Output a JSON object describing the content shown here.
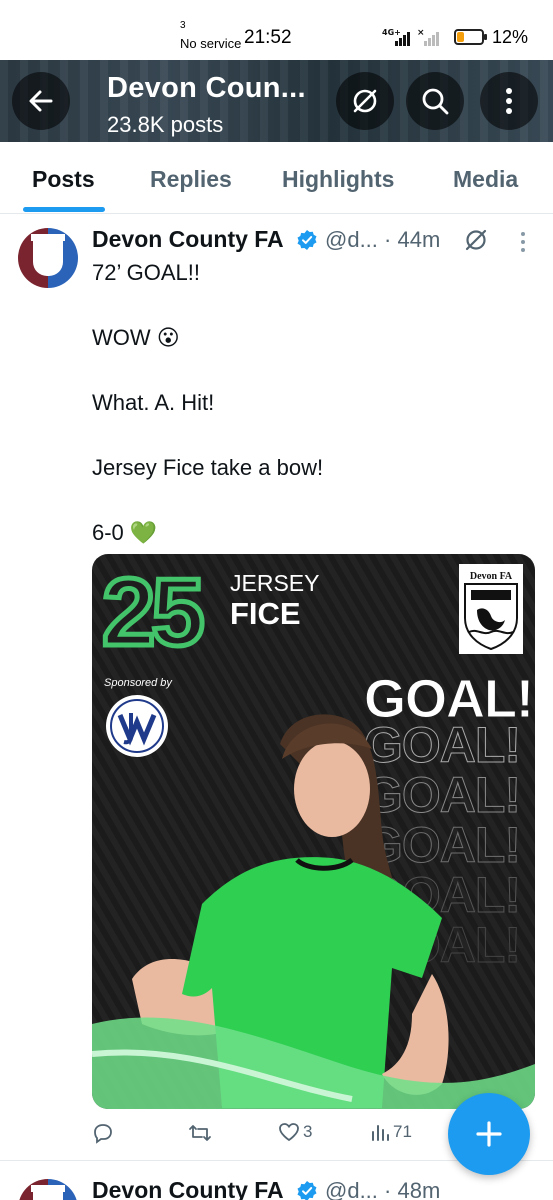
{
  "status_bar": {
    "sim_number": "3",
    "sim_status": "No service",
    "time": "21:52",
    "network": "4G+",
    "battery_percent": "12%"
  },
  "header": {
    "title": "Devon Coun...",
    "subtitle": "23.8K posts"
  },
  "tabs": [
    {
      "label": "Posts",
      "active": true
    },
    {
      "label": "Replies",
      "active": false
    },
    {
      "label": "Highlights",
      "active": false
    },
    {
      "label": "Media",
      "active": false
    }
  ],
  "post": {
    "author": "Devon County FA",
    "handle": "@d...",
    "time": "· 44m",
    "lines": [
      "72’ GOAL!!",
      "WOW 😮",
      "What. A. Hit!",
      "Jersey Fice take a bow!",
      "6-0 💚"
    ],
    "media": {
      "number": "25",
      "first_name": "JERSEY",
      "last_name": "FICE",
      "crest_text": "Devon FA",
      "sponsored_text": "Sponsored by",
      "goal_text": "GOAL!"
    },
    "actions": {
      "replies": "",
      "reposts": "",
      "likes": "3",
      "views": "71"
    }
  },
  "next_post": {
    "author": "Devon County FA",
    "handle": "@d...",
    "time": "· 48m"
  },
  "colors": {
    "accent": "#1d9bf0",
    "brand_green": "#43c46a",
    "jersey_green": "#2fcf52"
  }
}
